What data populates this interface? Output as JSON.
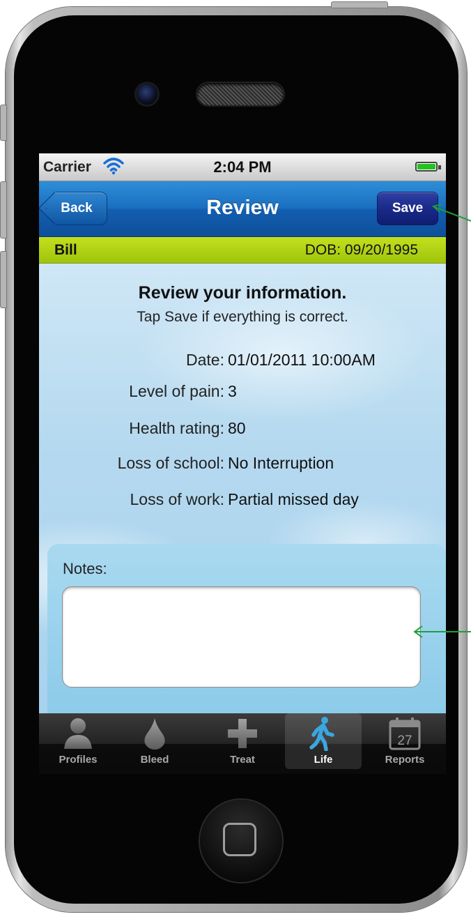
{
  "status_bar": {
    "carrier": "Carrier",
    "time": "2:04 PM"
  },
  "nav": {
    "back_label": "Back",
    "title": "Review",
    "save_label": "Save"
  },
  "profile": {
    "name": "Bill",
    "dob": "DOB: 09/20/1995"
  },
  "review": {
    "heading": "Review your information.",
    "subheading": "Tap Save if everything is correct.",
    "fields": [
      {
        "label": "Date:",
        "value": "01/01/2011 10:00AM"
      },
      {
        "label": "Level of pain:",
        "value": "3"
      },
      {
        "label": "Health rating:",
        "value": "80"
      },
      {
        "label": "Loss of school:",
        "value": "No Interruption"
      },
      {
        "label": "Loss of work:",
        "value": "Partial missed day"
      }
    ]
  },
  "notes": {
    "label": "Notes:",
    "value": ""
  },
  "tabs": [
    {
      "label": "Profiles",
      "icon": "person-icon",
      "selected": false
    },
    {
      "label": "Bleed",
      "icon": "drop-icon",
      "selected": false
    },
    {
      "label": "Treat",
      "icon": "cross-icon",
      "selected": false
    },
    {
      "label": "Life",
      "icon": "walking-person-icon",
      "selected": true
    },
    {
      "label": "Reports",
      "icon": "calendar-icon",
      "selected": false,
      "icon_text": "27"
    }
  ],
  "colors": {
    "nav_blue": "#1a6fc0",
    "save_navy": "#1a2a88",
    "profile_green": "#aed014",
    "annotation_green": "#1e9e3c",
    "life_icon_blue": "#3aa7e0"
  }
}
